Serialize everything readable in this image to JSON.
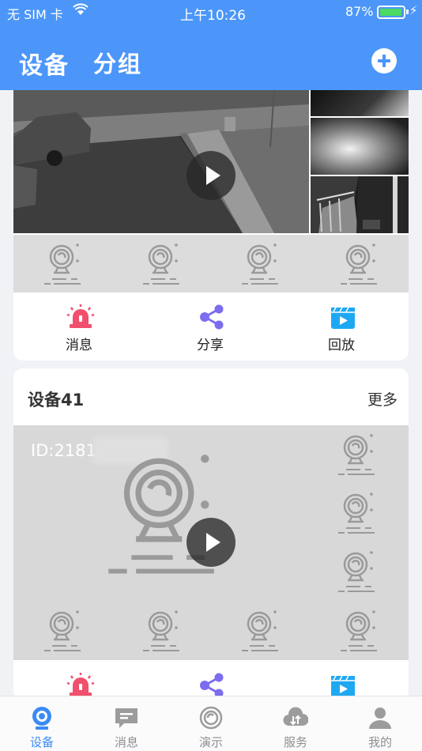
{
  "status_bar": {
    "carrier": "无 SIM 卡",
    "time": "上午10:26",
    "battery": "87%"
  },
  "header": {
    "tab_devices": "设备",
    "tab_groups": "分组",
    "add_icon": "plus-circle-icon"
  },
  "device_card_1": {
    "actions": [
      {
        "label": "消息",
        "icon": "alarm-light-icon"
      },
      {
        "label": "分享",
        "icon": "share-icon"
      },
      {
        "label": "回放",
        "icon": "playback-clapper-icon"
      }
    ]
  },
  "device_card_2": {
    "title": "设备41",
    "more": "更多",
    "id_label": "ID:2181",
    "actions": [
      {
        "label": "",
        "icon": "alarm-light-icon"
      },
      {
        "label": "",
        "icon": "share-icon"
      },
      {
        "label": "",
        "icon": "playback-clapper-icon"
      }
    ]
  },
  "tabbar": {
    "items": [
      {
        "label": "设备",
        "icon": "device-camera-icon",
        "active": true
      },
      {
        "label": "消息",
        "icon": "message-bubble-icon",
        "active": false
      },
      {
        "label": "演示",
        "icon": "demo-circle-icon",
        "active": false
      },
      {
        "label": "服务",
        "icon": "cloud-service-icon",
        "active": false
      },
      {
        "label": "我的",
        "icon": "profile-icon",
        "active": false
      }
    ]
  },
  "colors": {
    "accent": "#4b96f8",
    "alarm": "#f0506e",
    "share": "#7b6cf0",
    "playback": "#1fa8f2"
  }
}
